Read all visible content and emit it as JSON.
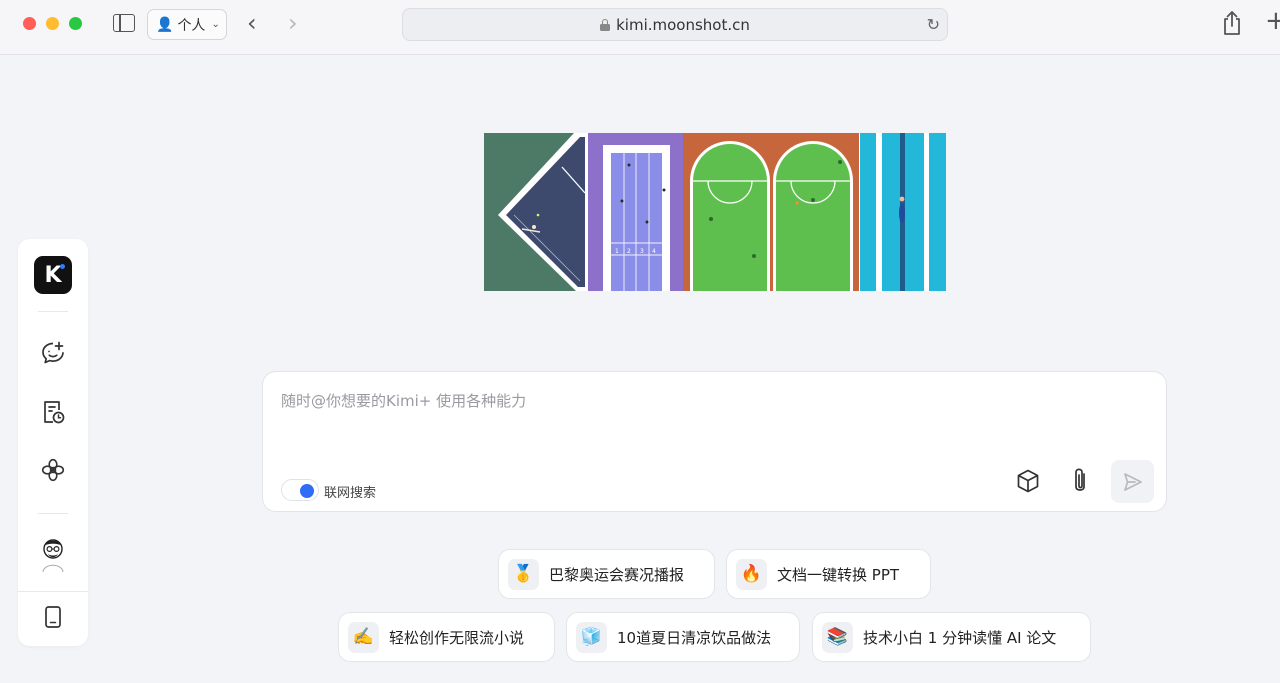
{
  "browser": {
    "profile_label": "个人",
    "url": "kimi.moonshot.cn"
  },
  "rail": {
    "logo_text": "K",
    "items": [
      {
        "name": "new-chat",
        "icon": "chat-plus-icon"
      },
      {
        "name": "history",
        "icon": "history-doc-icon"
      },
      {
        "name": "kimi-plus",
        "icon": "flower-icon"
      }
    ]
  },
  "chat": {
    "placeholder": "随时@你想要的Kimi+ 使用各种能力",
    "search_label": "联网搜索",
    "search_enabled": true
  },
  "suggestions": [
    {
      "emoji": "🥇",
      "label": "巴黎奥运会赛况播报"
    },
    {
      "emoji": "🔥",
      "label": "文档一键转换 PPT"
    },
    {
      "emoji": "✍️",
      "label": "轻松创作无限流小说"
    },
    {
      "emoji": "🧊",
      "label": "10道夏日清凉饮品做法"
    },
    {
      "emoji": "📚",
      "label": "技术小白 1 分钟读懂 AI 论文"
    }
  ],
  "colors": {
    "accent": "#2f6df6",
    "background": "#f3f4f8"
  }
}
